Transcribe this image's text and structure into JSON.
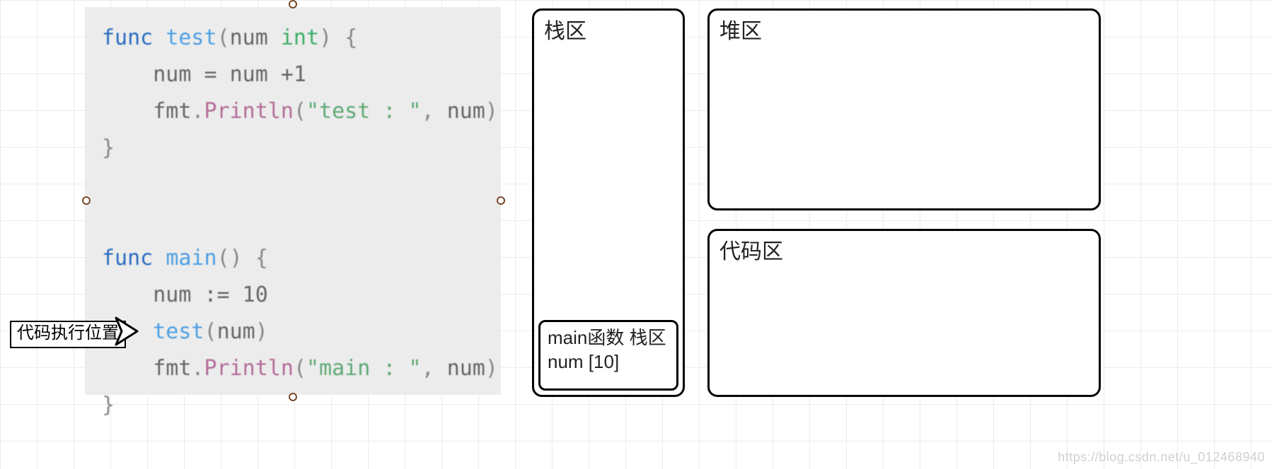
{
  "diagram": {
    "arrow_label": "代码执行位置",
    "code": {
      "func_test_sig_kw": "func",
      "func_test_name": "test",
      "func_test_param": "num",
      "func_test_type": "int",
      "test_body_assign": "num = num +1",
      "test_body_print_obj": "fmt",
      "test_body_print_fn": "Println",
      "test_body_print_str": "\"test : \"",
      "test_body_print_arg": "num",
      "func_main_sig_kw": "func",
      "func_main_name": "main",
      "main_body_decl": "num := 10",
      "main_body_call_fn": "test",
      "main_body_call_arg": "num",
      "main_body_print_obj": "fmt",
      "main_body_print_fn": "Println",
      "main_body_print_str": "\"main : \"",
      "main_body_print_arg": "num"
    },
    "regions": {
      "stack_label": "栈区",
      "heap_label": "堆区",
      "code_label": "代码区",
      "stack_frame_line1": "main函数 栈区",
      "stack_frame_line2": "num [10]"
    },
    "watermark": "https://blog.csdn.net/u_012468940"
  }
}
